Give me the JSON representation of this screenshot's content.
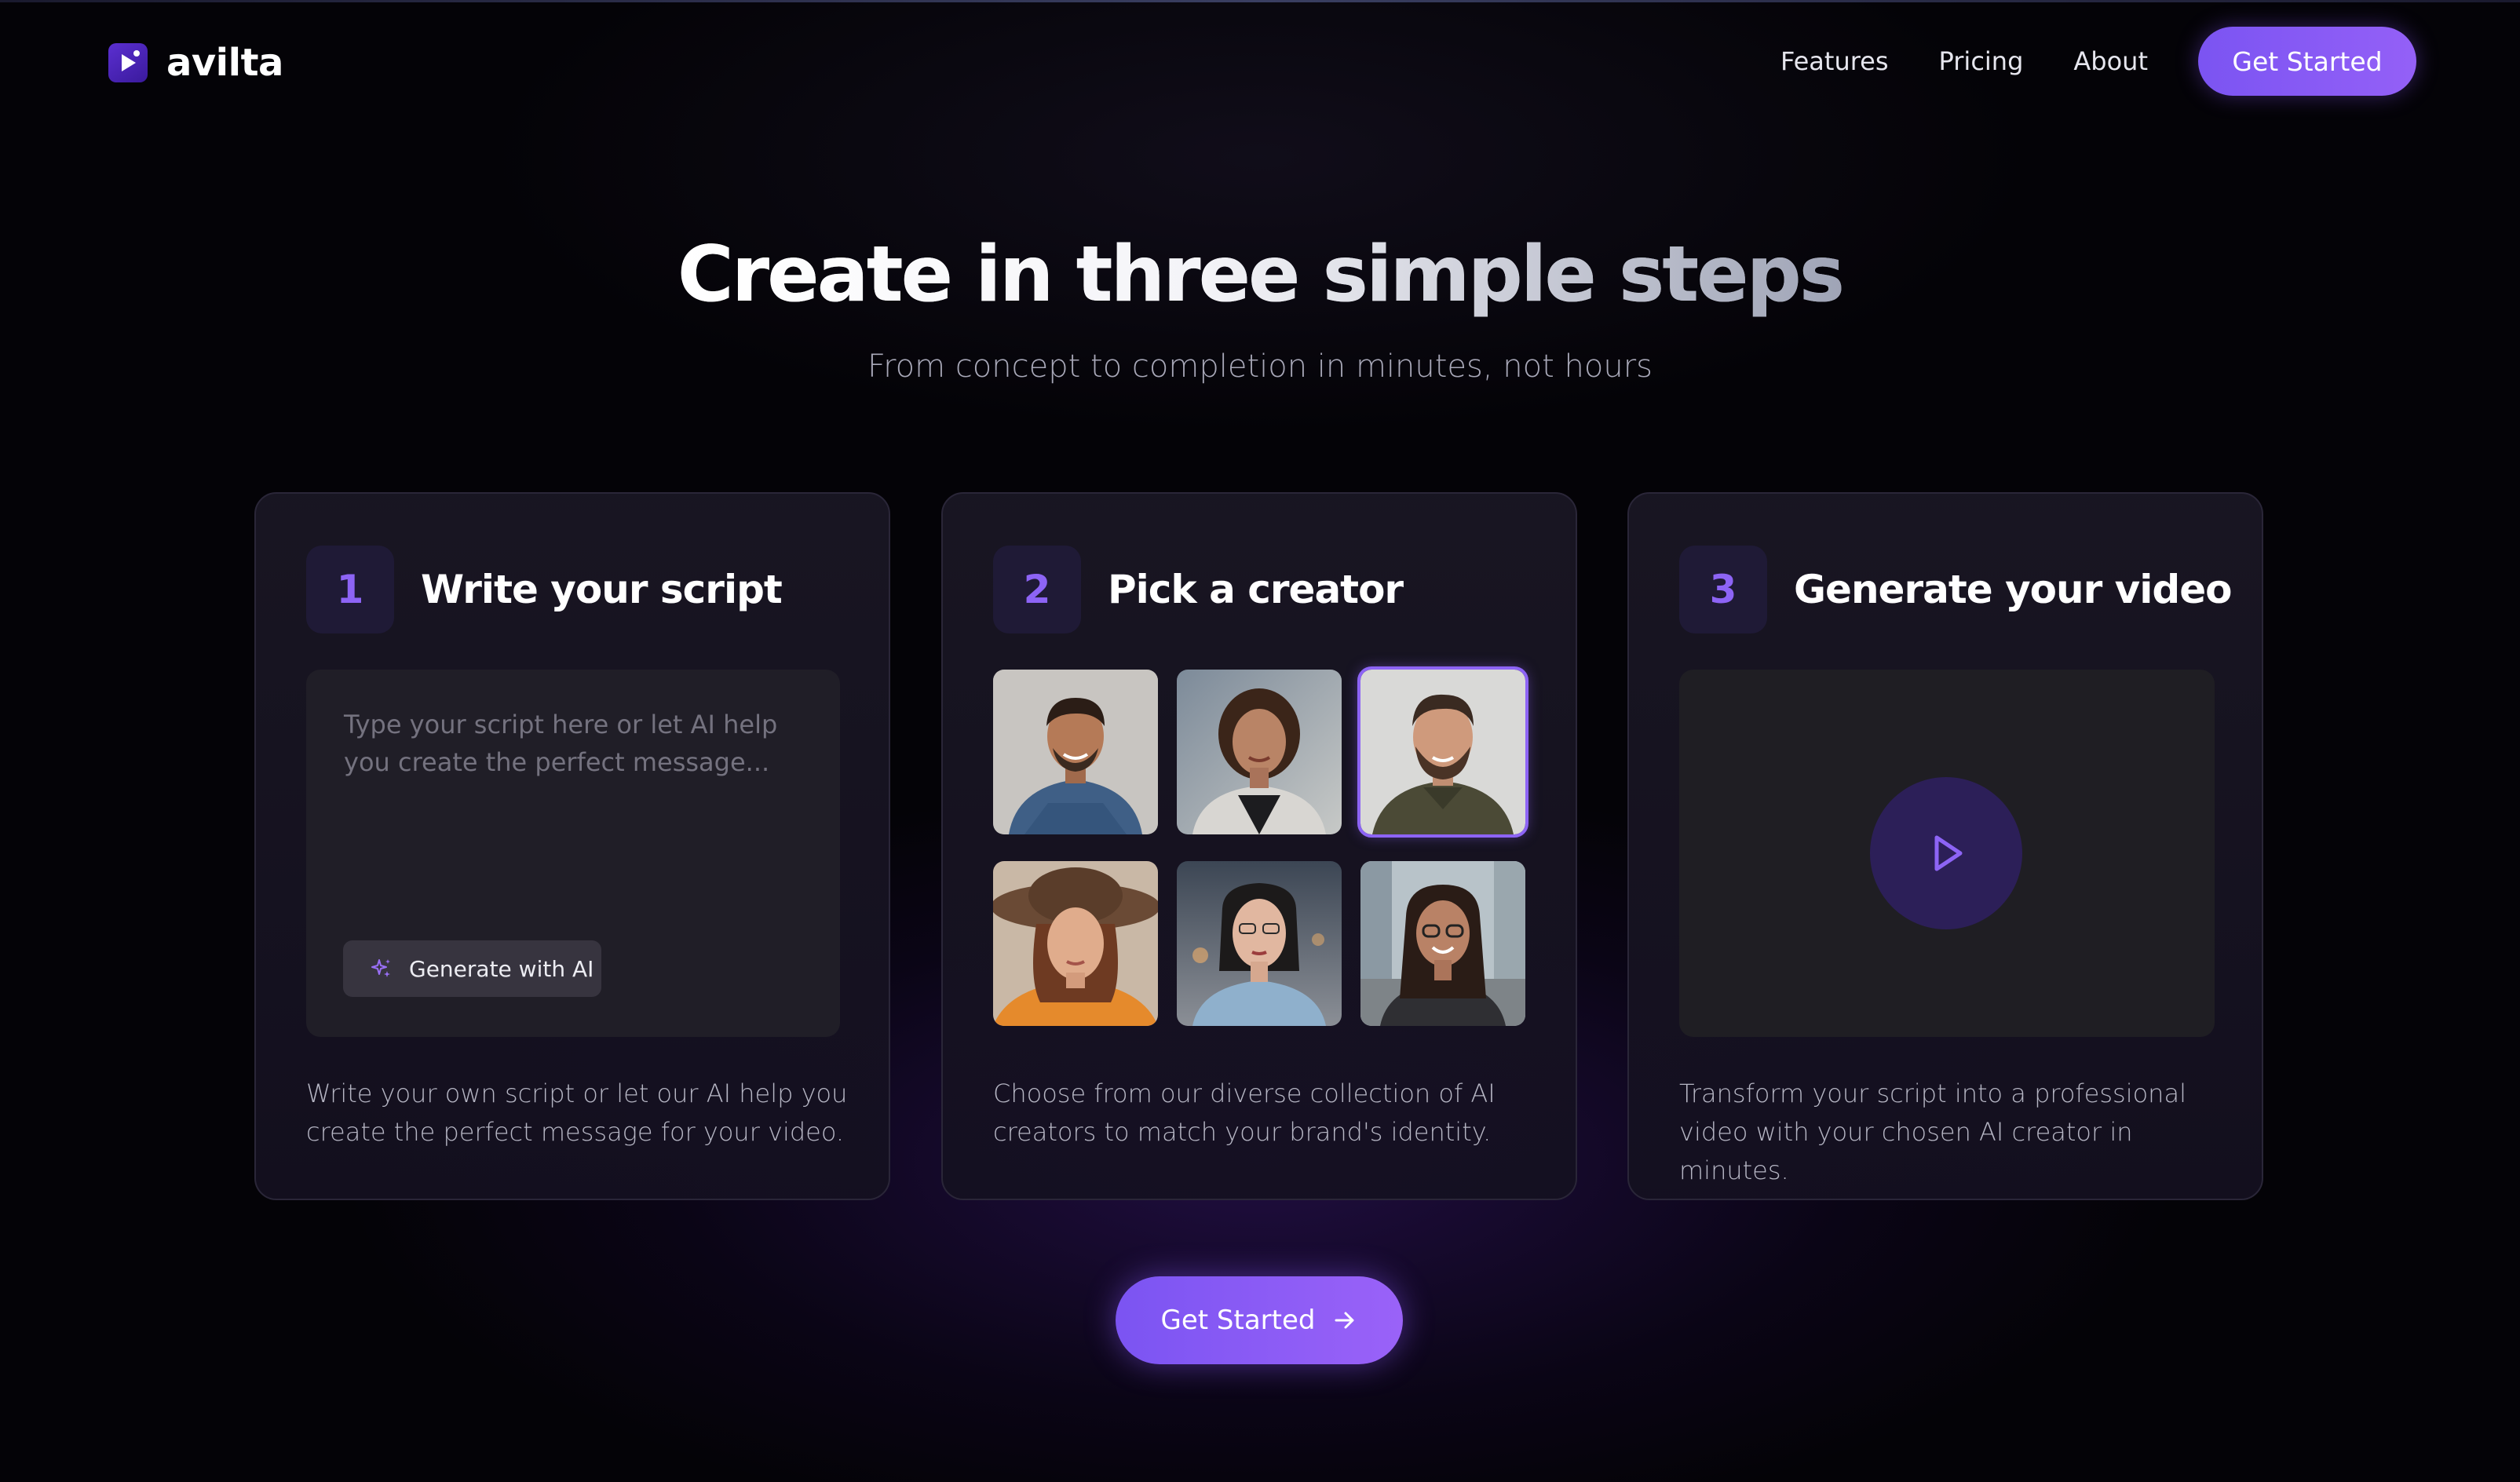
{
  "brand": {
    "name": "avilta",
    "accent": "#8d64f5"
  },
  "nav": {
    "links": [
      "Features",
      "Pricing",
      "About"
    ],
    "cta_label": "Get Started"
  },
  "hero": {
    "title": "Create in three simple steps",
    "subtitle": "From concept to completion in minutes, not hours"
  },
  "steps": [
    {
      "number": "1",
      "title": "Write your script",
      "placeholder": "Type your script here or let AI help you create the perfect message...",
      "generate_label": "Generate with AI",
      "description": "Write your own script or let our AI help you create the perfect message for your video."
    },
    {
      "number": "2",
      "title": "Pick a creator",
      "creators": [
        "creator-1",
        "creator-2",
        "creator-3",
        "creator-4",
        "creator-5",
        "creator-6"
      ],
      "selected_creator": 3,
      "description": "Choose from our diverse collection of AI creators to match your brand's identity."
    },
    {
      "number": "3",
      "title": "Generate your video",
      "description": "Transform your script into a professional video with your chosen AI creator in minutes."
    }
  ],
  "bottom_cta": {
    "label": "Get Started"
  }
}
